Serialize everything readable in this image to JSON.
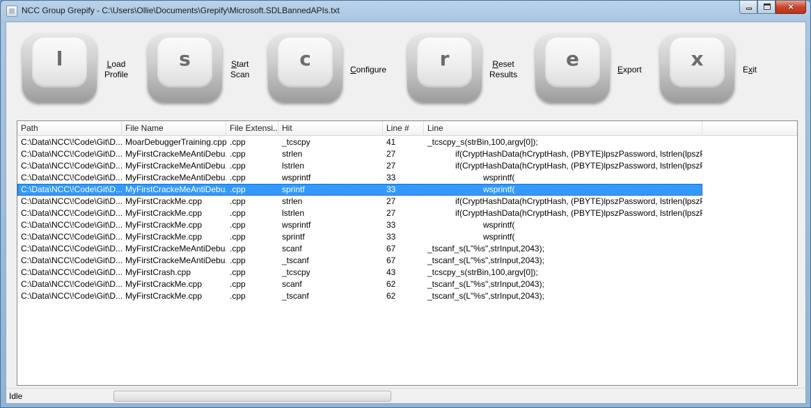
{
  "window": {
    "title": "NCC Group Grepify - C:\\Users\\Ollie\\Documents\\Grepify\\Microsoft.SDLBannedAPIs.txt",
    "controls": {
      "minimize": "minimize-icon",
      "maximize": "maximize-icon",
      "close": "×"
    }
  },
  "toolbar": {
    "load": {
      "key": "l",
      "underlined": "L",
      "rest1": "oad",
      "line2": "Profile"
    },
    "start": {
      "key": "s",
      "underlined": "S",
      "rest1": "tart",
      "line2": "Scan"
    },
    "configure": {
      "key": "c",
      "underlined": "C",
      "rest1": "onfigure"
    },
    "reset": {
      "key": "r",
      "underlined": "R",
      "rest1": "eset",
      "line2": "Results"
    },
    "export": {
      "key": "e",
      "underlined": "E",
      "rest1": "xport"
    },
    "exit": {
      "key": "x",
      "pre": "E",
      "underlined": "x",
      "rest1": "it"
    }
  },
  "results": {
    "columns": [
      "Path",
      "File Name",
      "File Extensi...",
      "Hit",
      "Line #",
      "Line"
    ],
    "selected_index": 4,
    "rows": [
      [
        "C:\\Data\\NCC\\!Code\\Git\\D...",
        "MoarDebuggerTraining.cpp",
        ".cpp",
        "_tcscpy",
        "41",
        "_tcscpy_s(strBin,100,argv[0]);"
      ],
      [
        "C:\\Data\\NCC\\!Code\\Git\\D...",
        "MyFirstCrackeMeAntiDebu...",
        ".cpp",
        "strlen",
        "27",
        "            if(CryptHashData(hCryptHash, (PBYTE)lpszPassword, lstrlen(lpszPasswor..."
      ],
      [
        "C:\\Data\\NCC\\!Code\\Git\\D...",
        "MyFirstCrackeMeAntiDebu...",
        ".cpp",
        "lstrlen",
        "27",
        "            if(CryptHashData(hCryptHash, (PBYTE)lpszPassword, lstrlen(lpszPasswor..."
      ],
      [
        "C:\\Data\\NCC\\!Code\\Git\\D...",
        "MyFirstCrackeMeAntiDebu...",
        ".cpp",
        "wsprintf",
        "33",
        "                        wsprintf("
      ],
      [
        "C:\\Data\\NCC\\!Code\\Git\\D...",
        "MyFirstCrackeMeAntiDebu...",
        ".cpp",
        "sprintf",
        "33",
        "                        wsprintf("
      ],
      [
        "C:\\Data\\NCC\\!Code\\Git\\D...",
        "MyFirstCrackMe.cpp",
        ".cpp",
        "strlen",
        "27",
        "            if(CryptHashData(hCryptHash, (PBYTE)lpszPassword, lstrlen(lpszPasswor..."
      ],
      [
        "C:\\Data\\NCC\\!Code\\Git\\D...",
        "MyFirstCrackMe.cpp",
        ".cpp",
        "lstrlen",
        "27",
        "            if(CryptHashData(hCryptHash, (PBYTE)lpszPassword, lstrlen(lpszPasswor..."
      ],
      [
        "C:\\Data\\NCC\\!Code\\Git\\D...",
        "MyFirstCrackMe.cpp",
        ".cpp",
        "wsprintf",
        "33",
        "                        wsprintf("
      ],
      [
        "C:\\Data\\NCC\\!Code\\Git\\D...",
        "MyFirstCrackMe.cpp",
        ".cpp",
        "sprintf",
        "33",
        "                        wsprintf("
      ],
      [
        "C:\\Data\\NCC\\!Code\\Git\\D...",
        "MyFirstCrackeMeAntiDebu...",
        ".cpp",
        "scanf",
        "67",
        "_tscanf_s(L\"%s\",strInput,2043);"
      ],
      [
        "C:\\Data\\NCC\\!Code\\Git\\D...",
        "MyFirstCrackeMeAntiDebu...",
        ".cpp",
        "_tscanf",
        "67",
        "_tscanf_s(L\"%s\",strInput,2043);"
      ],
      [
        "C:\\Data\\NCC\\!Code\\Git\\D...",
        "MyFirstCrash.cpp",
        ".cpp",
        "_tcscpy",
        "43",
        "_tcscpy_s(strBin,100,argv[0]);"
      ],
      [
        "C:\\Data\\NCC\\!Code\\Git\\D...",
        "MyFirstCrackMe.cpp",
        ".cpp",
        "scanf",
        "62",
        "_tscanf_s(L\"%s\",strInput,2043);"
      ],
      [
        "C:\\Data\\NCC\\!Code\\Git\\D...",
        "MyFirstCrackMe.cpp",
        ".cpp",
        "_tscanf",
        "62",
        "_tscanf_s(L\"%s\",strInput,2043);"
      ]
    ]
  },
  "status": {
    "text": "Idle",
    "progress": 0
  }
}
